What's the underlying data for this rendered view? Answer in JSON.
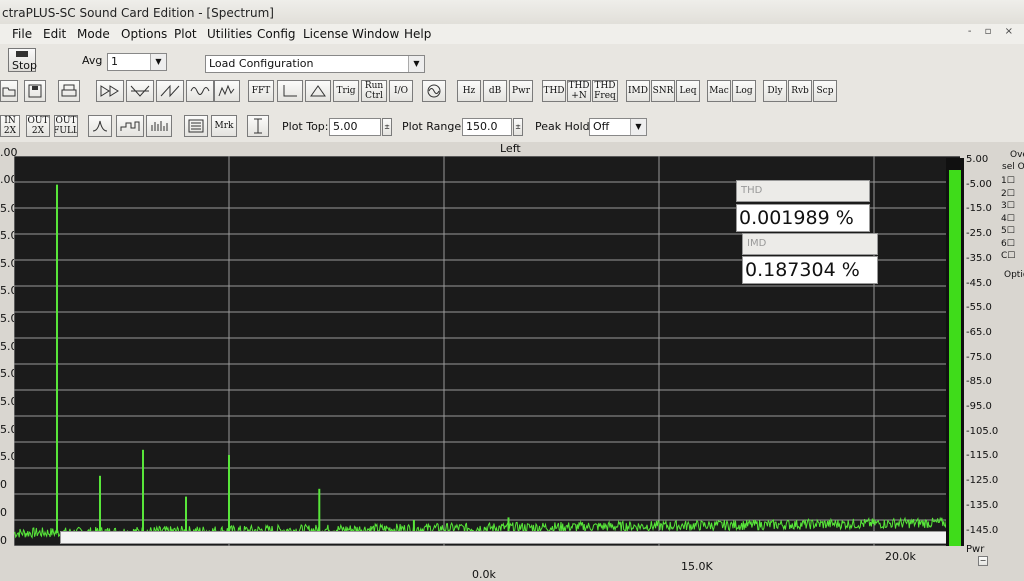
{
  "window": {
    "title": "ctraPLUS-SC Sound Card Edition - [Spectrum]",
    "mdi_controls": "- ▫ ×"
  },
  "menu": [
    "File",
    "Edit",
    "Mode",
    "Options",
    "Plot",
    "Utilities",
    "Config",
    "License",
    "Window",
    "Help"
  ],
  "toolbar": {
    "stop_label": "Stop",
    "avg_label": "Avg",
    "avg_value": "1",
    "config_value": "Load Configuration",
    "fft": "FFT",
    "trig": "Trig",
    "run_ctrl": "Run Ctrl",
    "io": "I/O",
    "hz": "Hz",
    "db": "dB",
    "pwr": "Pwr",
    "thd": "THD",
    "thdn": "THD +N",
    "thd_freq": "THD Freq",
    "imd": "IMD",
    "snr": "SNR",
    "leq": "Leq",
    "mac": "Mac",
    "log": "Log",
    "dly": "Dly",
    "rvb": "Rvb",
    "scp": "Scp",
    "zoom_in": "IN 2X",
    "zoom_out": "OUT 2X",
    "zoom_full": "OUT FULL",
    "mrk": "Mrk",
    "plot_top_label": "Plot Top:",
    "plot_top_value": "5.00",
    "plot_range_label": "Plot Range:",
    "plot_range_value": "150.0",
    "peak_hold_label": "Peak Hold:",
    "peak_hold_value": "Off"
  },
  "plot": {
    "channel_title": "Left",
    "y_labels": [
      ".00",
      ".00",
      "5.0",
      "5.0",
      "5.0",
      "5.0",
      "5.0",
      "5.0",
      "5.0",
      "5.0",
      "5.0",
      "5.0",
      "0",
      "0",
      "0"
    ],
    "x_labels": [
      "15.0K",
      "20.0k"
    ],
    "x_partial": "0.0k"
  },
  "readouts": {
    "thd_label": "THD",
    "thd_value": "0.001989 %",
    "imd_label": "IMD",
    "imd_value": "0.187304 %"
  },
  "meter": {
    "labels": [
      "5.00",
      "-5.00",
      "-15.0",
      "-25.0",
      "-35.0",
      "-45.0",
      "-55.0",
      "-65.0",
      "-75.0",
      "-85.0",
      "-95.0",
      "-105.0",
      "-115.0",
      "-125.0",
      "-135.0",
      "-145.0"
    ],
    "level_fraction": 0.97,
    "pwr_label": "Pwr",
    "fill_color": "#3fdc1a"
  },
  "right_panel": {
    "header_a": "Ove",
    "header_b": "sel On",
    "channels": [
      "1",
      "2",
      "3",
      "4",
      "5",
      "6",
      "C"
    ],
    "option_label": "Optio"
  },
  "chart_data": {
    "type": "line",
    "x_unit": "Hz",
    "xlim": [
      0,
      22000
    ],
    "ylim": [
      -145,
      5
    ],
    "noise_floor": -140,
    "peaks": [
      {
        "x": 1000,
        "y": -6
      },
      {
        "x": 2000,
        "y": -118
      },
      {
        "x": 3000,
        "y": -108
      },
      {
        "x": 4000,
        "y": -126
      },
      {
        "x": 5000,
        "y": -110
      },
      {
        "x": 7100,
        "y": -123
      },
      {
        "x": 9300,
        "y": -135
      },
      {
        "x": 11500,
        "y": -134
      }
    ],
    "line_color": "#58e63a",
    "grid": true
  }
}
